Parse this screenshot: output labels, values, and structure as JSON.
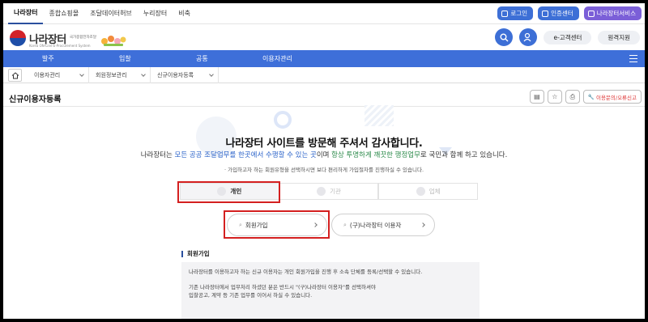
{
  "topnav": [
    "나라장터",
    "종합쇼핑몰",
    "조달데이터허브",
    "누리장터",
    "비축"
  ],
  "util_buttons": {
    "login": "로그인",
    "cert": "인증센터",
    "service": "나라장터서비스"
  },
  "logo": {
    "title": "나라장터",
    "sub1": "국가종합전자조달",
    "sub2": "Korea ON-Line E-Procurement System"
  },
  "header_buttons": {
    "customer": "e-고객센터",
    "remote": "원격지원"
  },
  "mainmenu": [
    "발주",
    "입찰",
    "공통",
    "이용자관리"
  ],
  "breadcrumb": [
    "이용자관리",
    "회원정보관리",
    "신규이용자등록"
  ],
  "page_title": "신규이용자등록",
  "report_label": "이용문의/오류신고",
  "welcome": {
    "heading": "나라장터 사이트를 방문해 주셔서 감사합니다.",
    "line_a": "나라장터는 ",
    "line_b": "모든 공공 조달업무를 한곳에서 수행할 수 있는 곳",
    "line_c": "이며 ",
    "line_d": "항상 투명하게 깨끗한 행정업무",
    "line_e": "로 국민과 함께 하고 있습니다.",
    "guide": "· 가입하고자 하는 회원유형을 선택하시면 보다 편리하게 가입절차를 진행하실 수 있습니다."
  },
  "member_types": [
    "개인",
    "기관",
    "업체"
  ],
  "join_buttons": {
    "member": "회원가입",
    "legacy": "(구)나라장터 이용자"
  },
  "info": {
    "title": "회원가입",
    "p1": "나라장터를 이용하고자 하는 신규 이용자는 개인 회원가입을 진행 후 소속 단체를 등록/선택할 수 있습니다.",
    "p2": "기존 나라장터에서 업무처리 하셨던 분은 반드시 \"(구)나라장터 이용자\"를 선택하셔야",
    "p3": "입찰공고, 계약 등 기존 업무를 이어서 하실 수 있습니다."
  },
  "colors": {
    "brand_blue": "#3e6fd9",
    "highlight_red": "#d42020",
    "service_purple": "#7b5fd8"
  }
}
